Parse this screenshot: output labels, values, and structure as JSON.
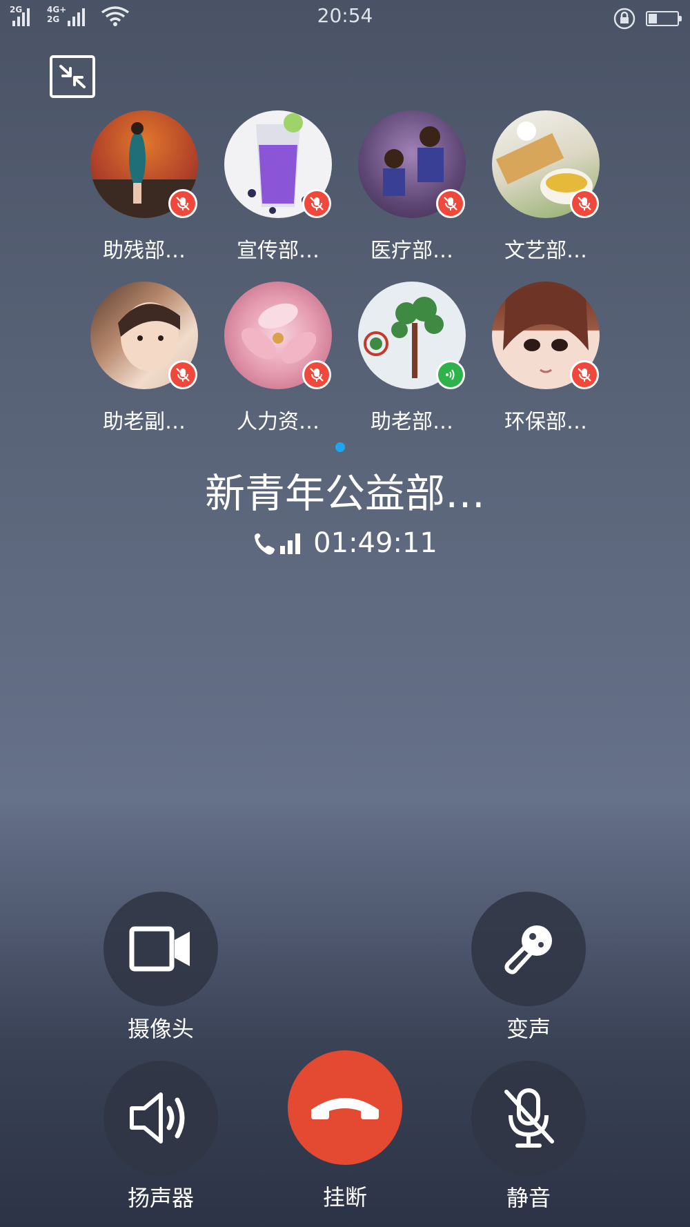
{
  "status_bar": {
    "net1": "2G",
    "net2_top": "4G+",
    "net2_bottom": "2G",
    "time": "20:54",
    "battery_level": 0.3
  },
  "minimize": {
    "icon": "minimize-icon"
  },
  "participants": [
    {
      "name": "助残部…",
      "status": "muted",
      "avatar_color": "#c0532a"
    },
    {
      "name": "宣传部…",
      "status": "muted",
      "avatar_color": "#8e5bd6"
    },
    {
      "name": "医疗部…",
      "status": "muted",
      "avatar_color": "#6b4d7a"
    },
    {
      "name": "文艺部…",
      "status": "muted",
      "avatar_color": "#d9c28a"
    },
    {
      "name": "助老副…",
      "status": "muted",
      "avatar_color": "#c7a58a"
    },
    {
      "name": "人力资…",
      "status": "muted",
      "avatar_color": "#e7a7b3"
    },
    {
      "name": "助老部…",
      "status": "speaking",
      "avatar_color": "#e9eef2"
    },
    {
      "name": "环保部…",
      "status": "muted",
      "avatar_color": "#8a4a38"
    }
  ],
  "call": {
    "group_name": "新青年公益部…",
    "duration": "01:49:11"
  },
  "controls": {
    "camera": "摄像头",
    "voice_changer": "变声",
    "speaker": "扬声器",
    "hangup": "挂断",
    "mute": "静音"
  },
  "colors": {
    "muted_badge": "#f0483a",
    "speaking_badge": "#2fb24a",
    "hangup": "#e34a31",
    "page_indicator": "#1ea5f0"
  }
}
